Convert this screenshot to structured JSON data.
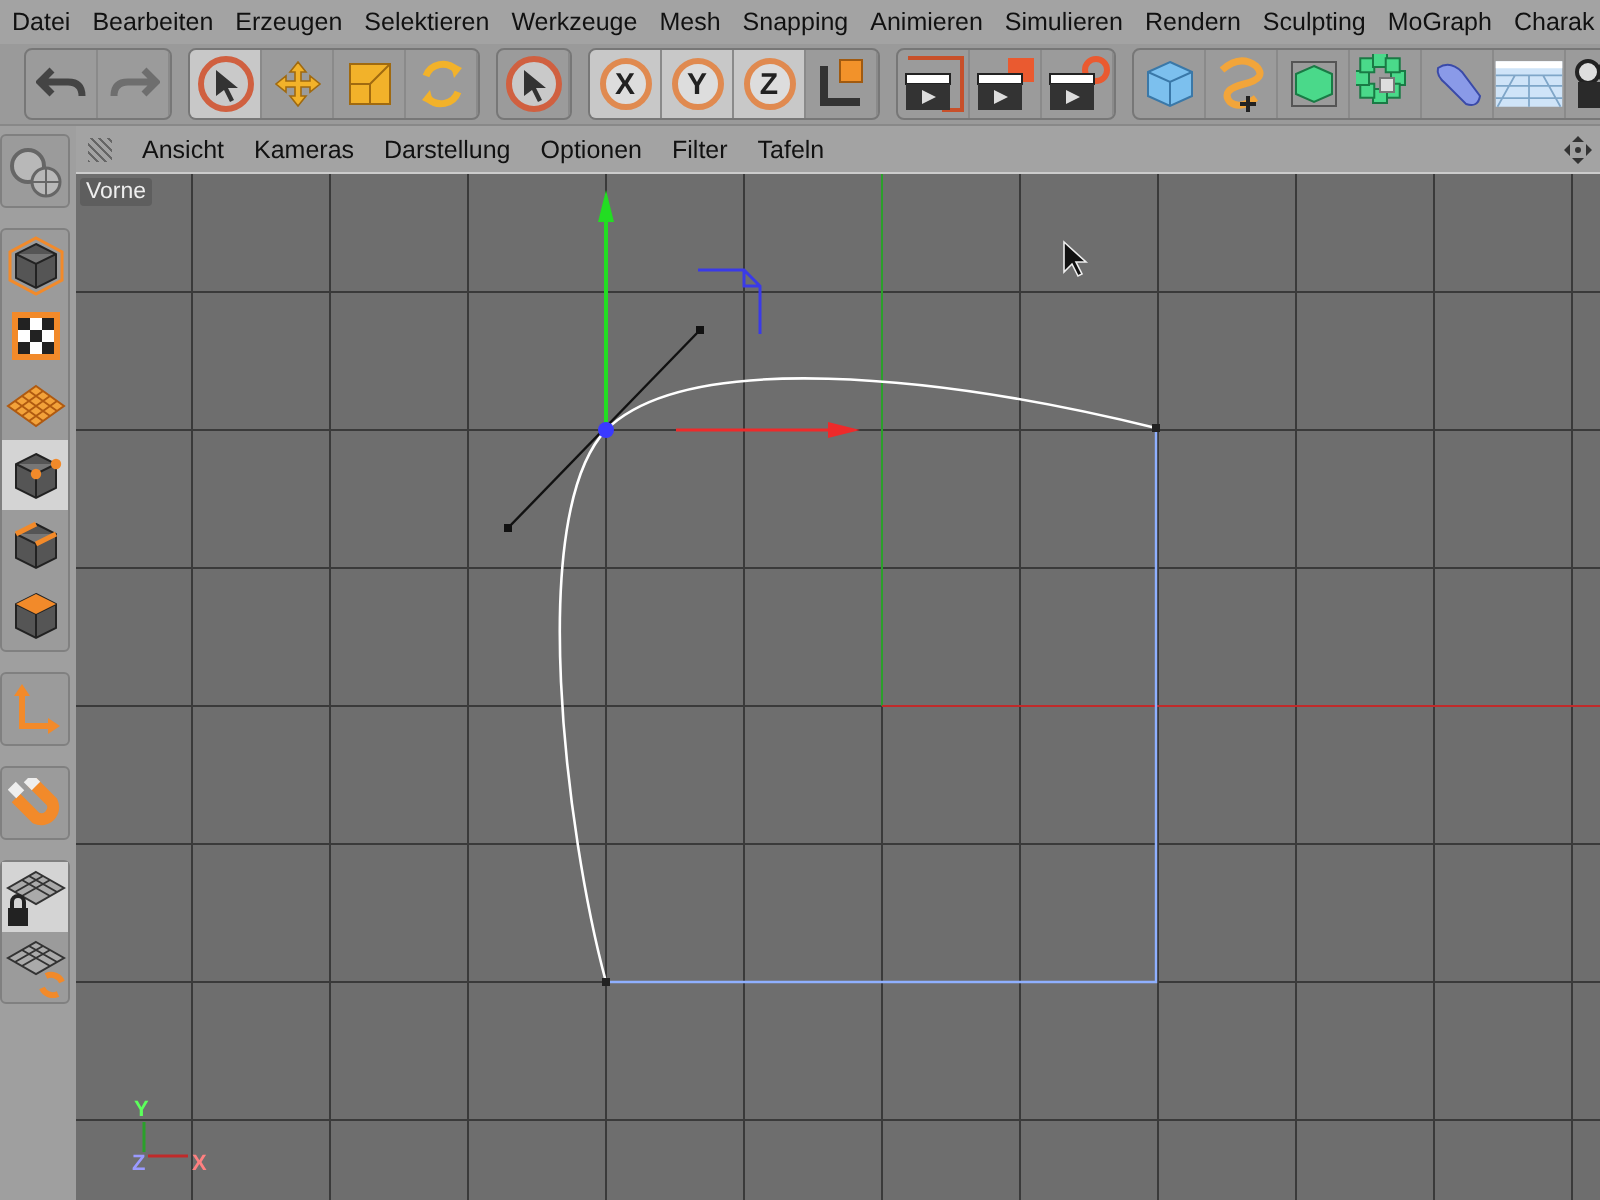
{
  "menu_bar": [
    "Datei",
    "Bearbeiten",
    "Erzeugen",
    "Selektieren",
    "Werkzeuge",
    "Mesh",
    "Snapping",
    "Animieren",
    "Simulieren",
    "Rendern",
    "Sculpting",
    "MoGraph",
    "Charak"
  ],
  "toolbar": [
    {
      "items": [
        {
          "kind": "undo",
          "selected": false
        },
        {
          "kind": "redo",
          "selected": false
        }
      ]
    },
    {
      "items": [
        {
          "kind": "select",
          "selected": true
        },
        {
          "kind": "move",
          "selected": false
        },
        {
          "kind": "scale",
          "selected": false
        },
        {
          "kind": "rotate",
          "selected": false
        }
      ]
    },
    {
      "items": [
        {
          "kind": "select",
          "selected": false
        }
      ]
    },
    {
      "items": [
        {
          "kind": "axis",
          "label": "X",
          "selected": true
        },
        {
          "kind": "axis",
          "label": "Y",
          "selected": true
        },
        {
          "kind": "axis",
          "label": "Z",
          "selected": true
        },
        {
          "kind": "coords",
          "selected": false
        }
      ]
    },
    {
      "items": [
        {
          "kind": "render-view",
          "selected": false
        },
        {
          "kind": "render-picture",
          "selected": false
        },
        {
          "kind": "render-settings",
          "selected": false
        }
      ]
    },
    {
      "items": [
        {
          "kind": "cube",
          "selected": false
        },
        {
          "kind": "spline",
          "selected": false
        },
        {
          "kind": "subdivision",
          "selected": false
        },
        {
          "kind": "cloner",
          "selected": false
        },
        {
          "kind": "deformer",
          "selected": false
        },
        {
          "kind": "floor",
          "selected": false
        },
        {
          "kind": "camera",
          "selected": false
        }
      ]
    }
  ],
  "left_palette": [
    {
      "items": [
        {
          "kind": "globe",
          "selected": false
        }
      ]
    },
    {
      "items": [
        {
          "kind": "model",
          "selected": false
        },
        {
          "kind": "texture",
          "selected": false
        },
        {
          "kind": "workplane",
          "selected": false
        },
        {
          "kind": "points",
          "selected": true
        },
        {
          "kind": "edges",
          "selected": false
        },
        {
          "kind": "polygons",
          "selected": false
        }
      ]
    },
    {
      "items": [
        {
          "kind": "axis-mode",
          "selected": false
        }
      ]
    },
    {
      "items": [
        {
          "kind": "snap",
          "selected": false
        }
      ]
    },
    {
      "items": [
        {
          "kind": "lock-grid",
          "selected": true
        },
        {
          "kind": "grid-sync",
          "selected": false
        }
      ]
    }
  ],
  "viewport_menu": [
    "Ansicht",
    "Kameras",
    "Darstellung",
    "Optionen",
    "Filter",
    "Tafeln"
  ],
  "viewport": {
    "label": "Vorne",
    "gizmo": {
      "y": "Y",
      "z": "Z",
      "x": "X"
    }
  }
}
